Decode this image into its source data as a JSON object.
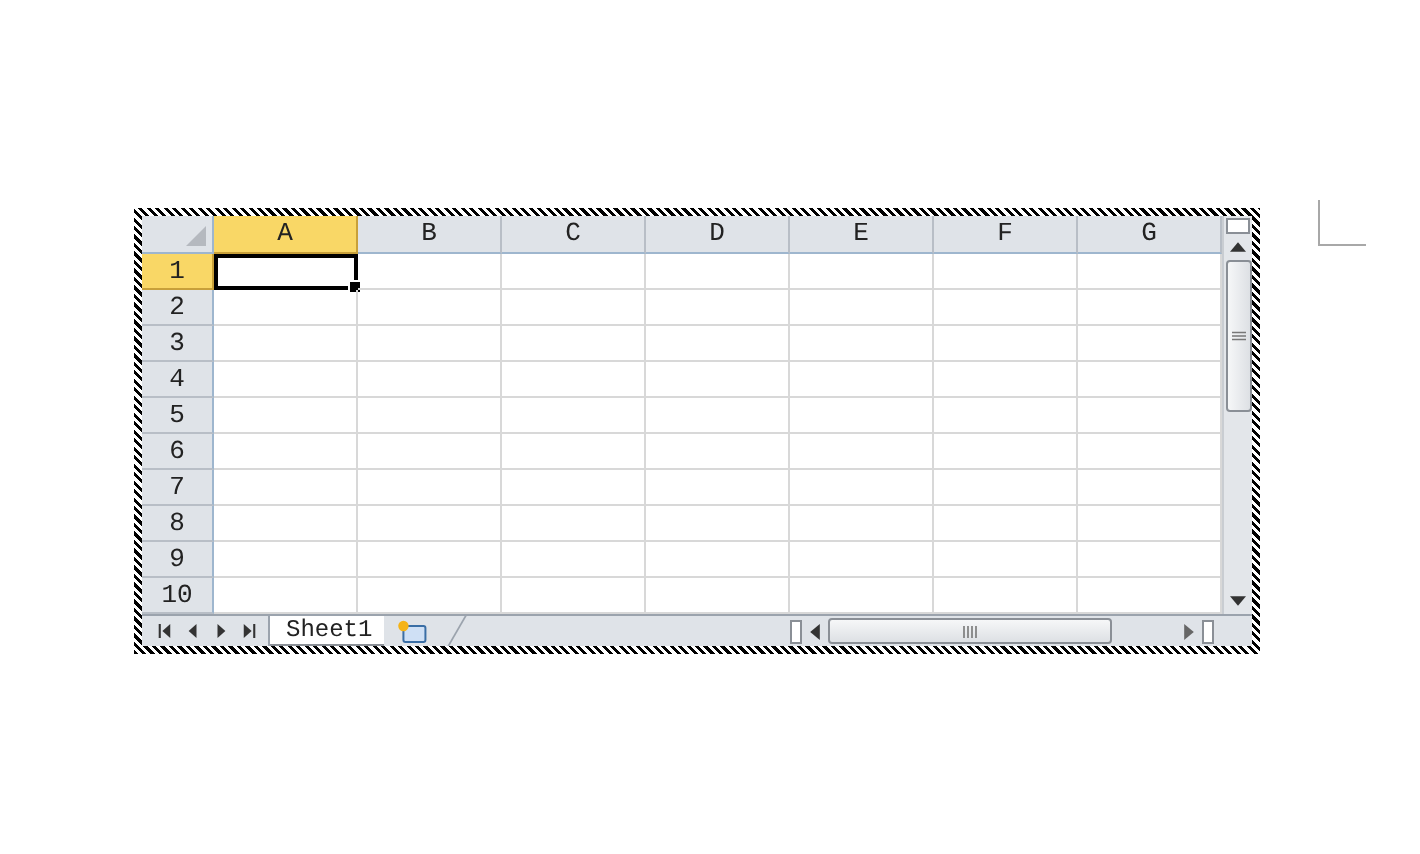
{
  "spreadsheet": {
    "columns": [
      {
        "label": "A",
        "selected": true
      },
      {
        "label": "B",
        "selected": false
      },
      {
        "label": "C",
        "selected": false
      },
      {
        "label": "D",
        "selected": false
      },
      {
        "label": "E",
        "selected": false
      },
      {
        "label": "F",
        "selected": false
      },
      {
        "label": "G",
        "selected": false
      }
    ],
    "rows": [
      {
        "label": "1",
        "selected": true
      },
      {
        "label": "2",
        "selected": false
      },
      {
        "label": "3",
        "selected": false
      },
      {
        "label": "4",
        "selected": false
      },
      {
        "label": "5",
        "selected": false
      },
      {
        "label": "6",
        "selected": false
      },
      {
        "label": "7",
        "selected": false
      },
      {
        "label": "8",
        "selected": false
      },
      {
        "label": "9",
        "selected": false
      },
      {
        "label": "10",
        "selected": false
      }
    ],
    "sheet_tabs": [
      {
        "label": "Sheet1",
        "selected": true
      }
    ]
  }
}
